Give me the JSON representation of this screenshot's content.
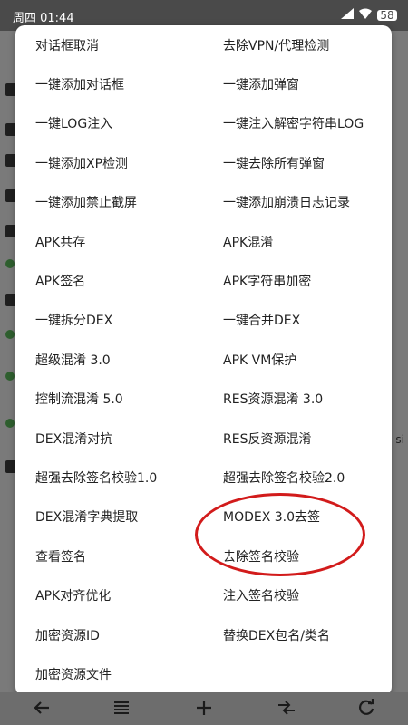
{
  "status_bar": {
    "time": "周四 01:44",
    "signal_icon": "signal-icon",
    "wifi_icon": "wifi-icon",
    "battery_label": "58"
  },
  "background": {
    "side_text": "si"
  },
  "menu": {
    "items": [
      {
        "left": "对话框取消",
        "right": "去除VPN/代理检测"
      },
      {
        "left": "一键添加对话框",
        "right": "一键添加弹窗"
      },
      {
        "left": "一键LOG注入",
        "right": "一键注入解密字符串LOG"
      },
      {
        "left": "一键添加XP检测",
        "right": "一键去除所有弹窗"
      },
      {
        "left": "一键添加禁止截屏",
        "right": "一键添加崩溃日志记录"
      },
      {
        "left": "APK共存",
        "right": "APK混淆"
      },
      {
        "left": "APK签名",
        "right": "APK字符串加密"
      },
      {
        "left": "一键拆分DEX",
        "right": "一键合并DEX"
      },
      {
        "left": "超级混淆 3.0",
        "right": "APK VM保护"
      },
      {
        "left": "控制流混淆 5.0",
        "right": "RES资源混淆 3.0"
      },
      {
        "left": "DEX混淆对抗",
        "right": "RES反资源混淆"
      },
      {
        "left": "超强去除签名校验1.0",
        "right": "超强去除签名校验2.0"
      },
      {
        "left": "DEX混淆字典提取",
        "right": "MODEX 3.0去签"
      },
      {
        "left": "查看签名",
        "right": "去除签名校验"
      },
      {
        "left": "APK对齐优化",
        "right": "注入签名校验"
      },
      {
        "left": "加密资源ID",
        "right": "替换DEX包名/类名"
      },
      {
        "left": "加密资源文件",
        "right": ""
      }
    ]
  },
  "bottom_bar": {
    "back_icon": "arrow-left-icon",
    "menu_icon": "list-icon",
    "add_icon": "plus-icon",
    "swap_icon": "swap-arrows-icon",
    "refresh_icon": "refresh-icon"
  },
  "colors": {
    "highlight_circle": "#d21b1b",
    "dialog_bg": "#ffffff",
    "overlay": "#6d6d6d"
  }
}
